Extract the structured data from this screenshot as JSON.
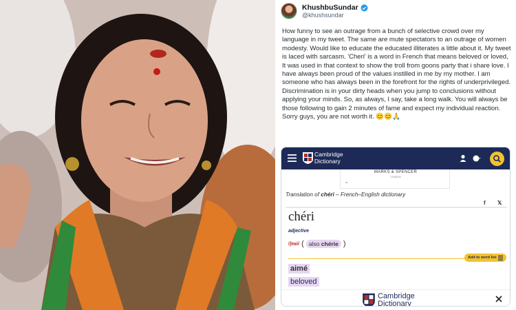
{
  "tweet": {
    "display_name": "KhushbuSundar",
    "handle": "@khushsundar",
    "text": "How funny to see an outrage from a bunch of selective crowd over my language in my tweet. The same are mute spectators to an outrage of women modesty. Would like to educate the educated illiterates a little about it. My tweet is laced with sarcasm. 'Cheri' is a word in French that means beloved or loved,  It was used in that context to show the troll from goons party that i share love. I have always been proud of the values instilled in me by my mother. I am someone who has always been in the forefront for the rights of underprivileged. Discrimination is in your dirty heads when you jump to conclusions without applying your minds. So, as always, I say, take a long walk. You will always be those following to gain 2 minutes of fame and expect my individual reaction. Sorry guys, you are not worth it. 😊😊🙏"
  },
  "dictionary": {
    "brand_line1": "Cambridge",
    "brand_line2": "Dictionary",
    "ad_brand": "MARKS & SPENCER",
    "ad_sub": "LONDON",
    "ad_eq": "=",
    "translation_prefix": "Translation of ",
    "translation_word": "chéri",
    "translation_suffix": " – French–English dictionary",
    "share_fb": "f",
    "share_x": "𝕏",
    "headword": "chéri",
    "pos": "adjective",
    "ipa": "/ʃeʁi/",
    "paren_open": "(",
    "paren_close": ")",
    "also_label": "also",
    "also_word": "chérie",
    "add_button": "Add to word list",
    "translations": [
      "aimé",
      "beloved"
    ],
    "overlay_line1": "Cambridge",
    "overlay_line2": "Dictionary"
  },
  "icons": [
    "verified-icon",
    "hamburger-icon",
    "user-icon",
    "globe-icon",
    "search-icon",
    "close-icon",
    "facebook-icon",
    "x-icon"
  ],
  "colors": {
    "cambridge_navy": "#1d2a57",
    "cambridge_yellow": "#f2c230",
    "highlight_purple": "#e6d6f2",
    "verified_blue": "#1d9bf0"
  }
}
